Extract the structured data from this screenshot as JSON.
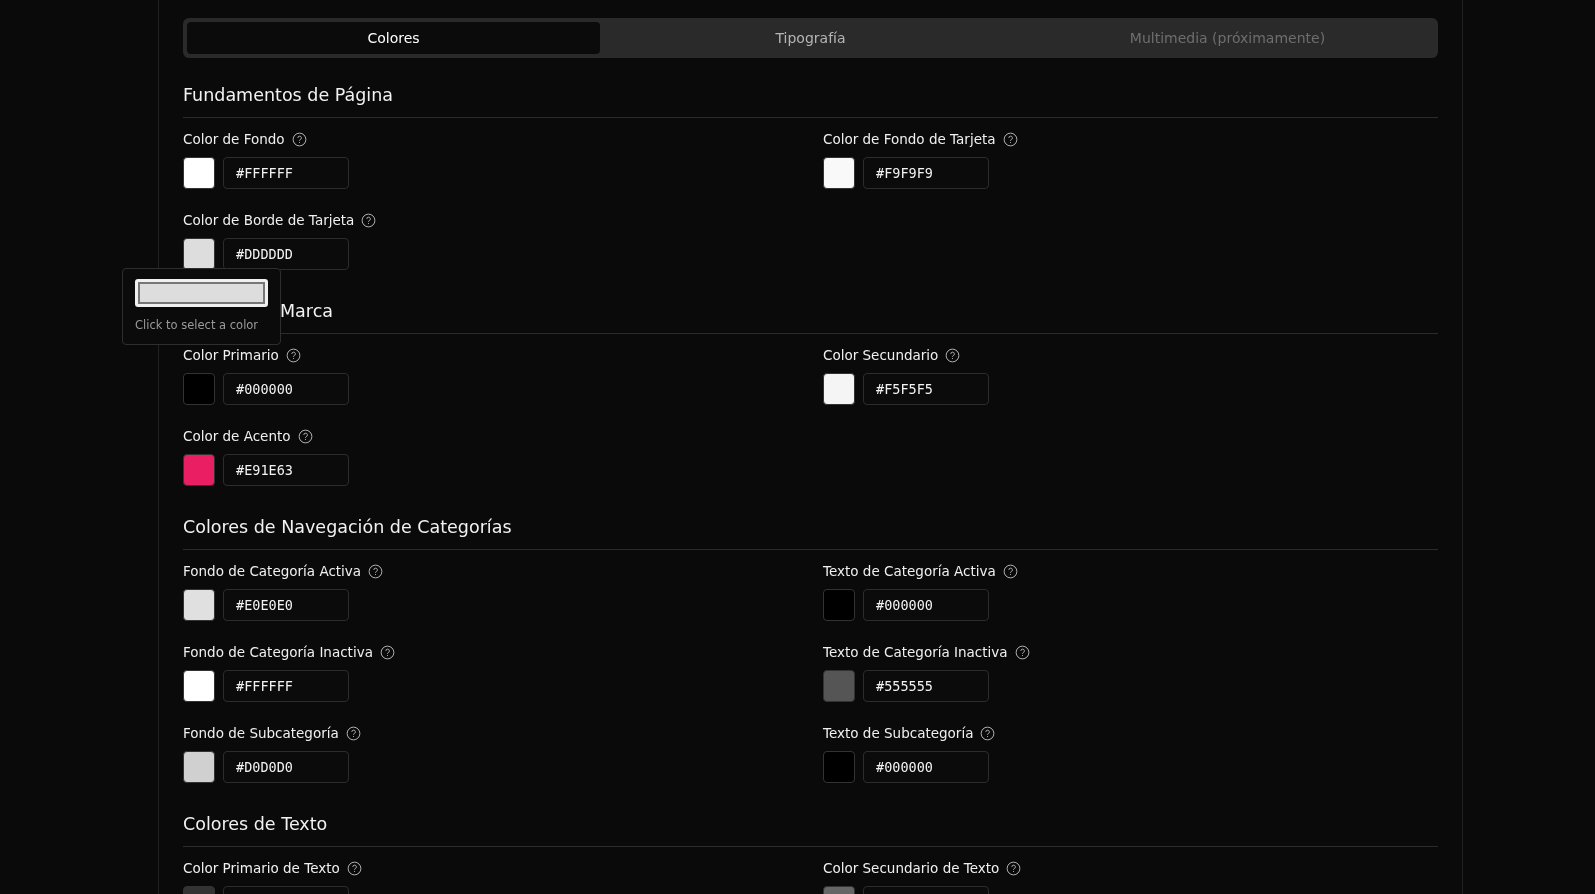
{
  "tabs": [
    {
      "label": "Colores",
      "selected": true,
      "disabled": false
    },
    {
      "label": "Tipografía",
      "selected": false,
      "disabled": false
    },
    {
      "label": "Multimedia (próximamente)",
      "selected": false,
      "disabled": true
    }
  ],
  "sections": [
    {
      "title": "Fundamentos de Página",
      "partially_hidden": false,
      "fields": [
        {
          "label": "Color de Fondo",
          "color": "#ffffff",
          "value": "#FFFFFF"
        },
        {
          "label": "Color de Fondo de Tarjeta",
          "color": "#f9f9f9",
          "value": "#F9F9F9"
        },
        {
          "label": "Color de Borde de Tarjeta",
          "color": "#dddddd",
          "value": "#DDDDDD"
        }
      ]
    },
    {
      "title": "Marca",
      "partially_hidden": true,
      "fields": [
        {
          "label": "Color Primario",
          "color": "#000000",
          "value": "#000000"
        },
        {
          "label": "Color Secundario",
          "color": "#f5f5f5",
          "value": "#F5F5F5"
        },
        {
          "label": "Color de Acento",
          "color": "#e91e63",
          "value": "#E91E63"
        }
      ]
    },
    {
      "title": "Colores de Navegación de Categorías",
      "partially_hidden": false,
      "fields": [
        {
          "label": "Fondo de Categoría Activa",
          "color": "#e0e0e0",
          "value": "#E0E0E0"
        },
        {
          "label": "Texto de Categoría Activa",
          "color": "#000000",
          "value": "#000000"
        },
        {
          "label": "Fondo de Categoría Inactiva",
          "color": "#ffffff",
          "value": "#FFFFFF"
        },
        {
          "label": "Texto de Categoría Inactiva",
          "color": "#555555",
          "value": "#555555"
        },
        {
          "label": "Fondo de Subcategoría",
          "color": "#d0d0d0",
          "value": "#D0D0D0"
        },
        {
          "label": "Texto de Subcategoría",
          "color": "#000000",
          "value": "#000000"
        }
      ]
    },
    {
      "title": "Colores de Texto",
      "partially_hidden": false,
      "fields": [
        {
          "label": "Color Primario de Texto",
          "color": "#333333"
        },
        {
          "label": "Color Secundario de Texto",
          "color": "#666666"
        }
      ]
    }
  ],
  "popover": {
    "color": "#dddddd",
    "hint": "Click to select a color"
  }
}
